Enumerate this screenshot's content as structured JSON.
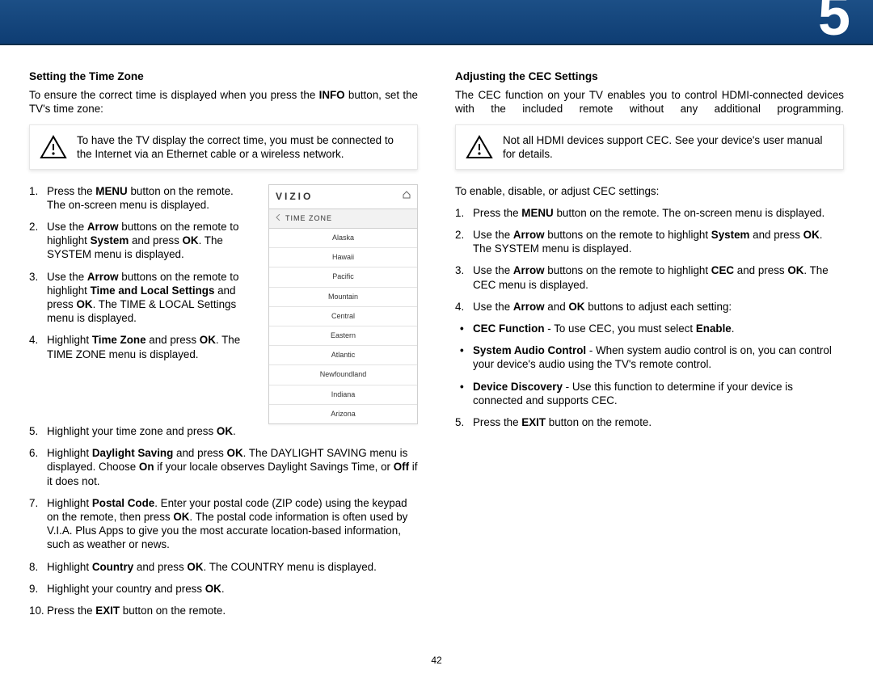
{
  "chapter_number": "5",
  "page_number": "42",
  "left": {
    "title": "Setting the Time Zone",
    "intro_pre": "To ensure the correct time is displayed when you press the ",
    "intro_bold": "INFO",
    "intro_post": " button, set the TV's time zone:",
    "callout": "To have the TV display the correct time, you must be connected to the Internet via an Ethernet cable or a wireless network.",
    "steps": [
      [
        [
          "t",
          "Press the "
        ],
        [
          "b",
          "MENU"
        ],
        [
          "t",
          " button on the remote. The on-screen menu is displayed."
        ]
      ],
      [
        [
          "t",
          "Use the "
        ],
        [
          "b",
          "Arrow"
        ],
        [
          "t",
          " buttons on the remote to highlight "
        ],
        [
          "b",
          "System"
        ],
        [
          "t",
          " and press "
        ],
        [
          "b",
          "OK"
        ],
        [
          "t",
          ". The SYSTEM menu is displayed."
        ]
      ],
      [
        [
          "t",
          "Use the "
        ],
        [
          "b",
          "Arrow"
        ],
        [
          "t",
          " buttons on the remote to highlight "
        ],
        [
          "b",
          "Time and Local Settings"
        ],
        [
          "t",
          " and press "
        ],
        [
          "b",
          "OK"
        ],
        [
          "t",
          ". The TIME & LOCAL Settings menu is displayed."
        ]
      ],
      [
        [
          "t",
          "Highlight "
        ],
        [
          "b",
          "Time Zone"
        ],
        [
          "t",
          " and press "
        ],
        [
          "b",
          "OK"
        ],
        [
          "t",
          ". The TIME ZONE menu is displayed."
        ]
      ],
      [
        [
          "t",
          "Highlight your time zone and press "
        ],
        [
          "b",
          "OK"
        ],
        [
          "t",
          "."
        ]
      ],
      [
        [
          "t",
          "Highlight "
        ],
        [
          "b",
          "Daylight Saving"
        ],
        [
          "t",
          " and press "
        ],
        [
          "b",
          "OK"
        ],
        [
          "t",
          ". The DAYLIGHT SAVING menu is displayed. Choose "
        ],
        [
          "b",
          "On"
        ],
        [
          "t",
          " if your locale observes Daylight Savings Time, or "
        ],
        [
          "b",
          "Off"
        ],
        [
          "t",
          " if it does not."
        ]
      ],
      [
        [
          "t",
          "Highlight "
        ],
        [
          "b",
          "Postal Code"
        ],
        [
          "t",
          ". Enter your postal code (ZIP code) using the keypad on the remote, then press "
        ],
        [
          "b",
          "OK"
        ],
        [
          "t",
          ". The postal code information is often used by V.I.A. Plus Apps to give you the most accurate location-based information, such as weather or news."
        ]
      ],
      [
        [
          "t",
          "Highlight "
        ],
        [
          "b",
          "Country"
        ],
        [
          "t",
          " and press "
        ],
        [
          "b",
          "OK"
        ],
        [
          "t",
          ". The COUNTRY menu is displayed."
        ]
      ],
      [
        [
          "t",
          "Highlight your country and press "
        ],
        [
          "b",
          "OK"
        ],
        [
          "t",
          "."
        ]
      ],
      [
        [
          "t",
          "Press the "
        ],
        [
          "b",
          "EXIT"
        ],
        [
          "t",
          " button on the remote."
        ]
      ]
    ]
  },
  "osd": {
    "brand": "VIZIO",
    "menu_title": "TIME ZONE",
    "options": [
      "Alaska",
      "Hawaii",
      "Pacific",
      "Mountain",
      "Central",
      "Eastern",
      "Atlantic",
      "Newfoundland",
      "Indiana",
      "Arizona"
    ]
  },
  "right": {
    "title": "Adjusting the CEC Settings",
    "intro": "The CEC function on your TV enables you to control HDMI-connected devices with the included remote without any additional programming.",
    "callout": "Not all HDMI devices support CEC. See your device's user manual for details.",
    "lead": "To enable, disable, or adjust CEC settings:",
    "steps": [
      [
        [
          "t",
          "Press the "
        ],
        [
          "b",
          "MENU"
        ],
        [
          "t",
          " button on the remote. The on-screen menu is displayed."
        ]
      ],
      [
        [
          "t",
          "Use the "
        ],
        [
          "b",
          "Arrow"
        ],
        [
          "t",
          " buttons on the remote to highlight "
        ],
        [
          "b",
          "System"
        ],
        [
          "t",
          " and press "
        ],
        [
          "b",
          "OK"
        ],
        [
          "t",
          ". The SYSTEM menu is displayed."
        ]
      ],
      [
        [
          "t",
          "Use the "
        ],
        [
          "b",
          "Arrow"
        ],
        [
          "t",
          " buttons on the remote to highlight "
        ],
        [
          "b",
          "CEC"
        ],
        [
          "t",
          " and press "
        ],
        [
          "b",
          "OK"
        ],
        [
          "t",
          ". The CEC menu is displayed."
        ]
      ],
      [
        [
          "t",
          "Use the "
        ],
        [
          "b",
          "Arrow"
        ],
        [
          "t",
          " and "
        ],
        [
          "b",
          "OK"
        ],
        [
          "t",
          " buttons to adjust each setting:"
        ]
      ]
    ],
    "bullets": [
      [
        [
          "b",
          "CEC Function"
        ],
        [
          "t",
          " - To use CEC, you must select "
        ],
        [
          "b",
          "Enable"
        ],
        [
          "t",
          "."
        ]
      ],
      [
        [
          "b",
          "System Audio Control"
        ],
        [
          "t",
          " - When system audio control is on, you can control your device's audio using the TV's remote control."
        ]
      ],
      [
        [
          "b",
          "Device Discovery"
        ],
        [
          "t",
          " - Use this function to determine if your device is connected and supports CEC."
        ]
      ]
    ],
    "final_step": [
      [
        "t",
        "Press the "
      ],
      [
        "b",
        "EXIT"
      ],
      [
        "t",
        " button on the remote."
      ]
    ]
  }
}
